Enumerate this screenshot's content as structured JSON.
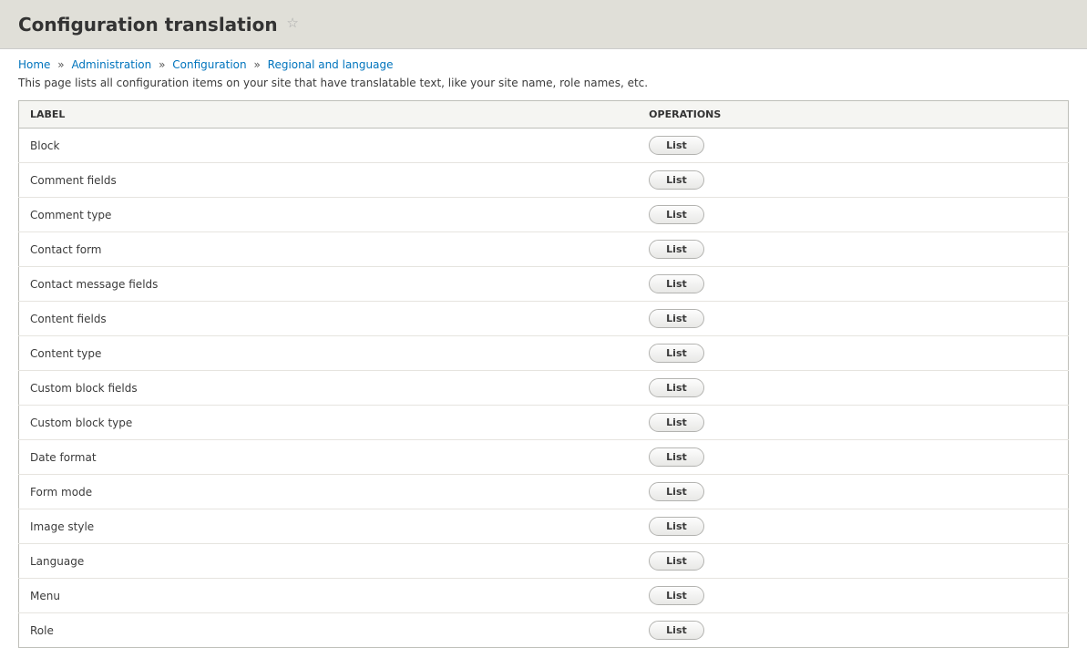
{
  "header": {
    "title": "Configuration translation"
  },
  "breadcrumb": {
    "home": "Home",
    "administration": "Administration",
    "configuration": "Configuration",
    "regional": "Regional and language",
    "sep": "»"
  },
  "description": "This page lists all configuration items on your site that have translatable text, like your site name, role names, etc.",
  "table": {
    "columns": {
      "label": "Label",
      "operations": "Operations"
    },
    "op_button": "List",
    "rows": [
      {
        "label": "Block"
      },
      {
        "label": "Comment fields"
      },
      {
        "label": "Comment type"
      },
      {
        "label": "Contact form"
      },
      {
        "label": "Contact message fields"
      },
      {
        "label": "Content fields"
      },
      {
        "label": "Content type"
      },
      {
        "label": "Custom block fields"
      },
      {
        "label": "Custom block type"
      },
      {
        "label": "Date format"
      },
      {
        "label": "Form mode"
      },
      {
        "label": "Image style"
      },
      {
        "label": "Language"
      },
      {
        "label": "Menu"
      },
      {
        "label": "Role"
      }
    ]
  }
}
